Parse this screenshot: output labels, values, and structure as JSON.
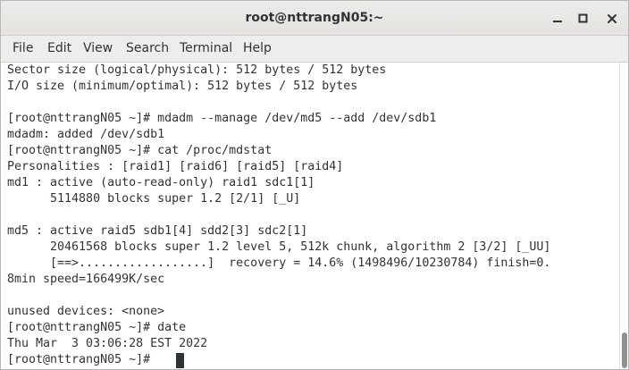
{
  "window": {
    "title": "root@nttrangN05:~"
  },
  "menu": {
    "items": [
      "File",
      "Edit",
      "View",
      "Search",
      "Terminal",
      "Help"
    ]
  },
  "terminal": {
    "lines": [
      "Sector size (logical/physical): 512 bytes / 512 bytes",
      "I/O size (minimum/optimal): 512 bytes / 512 bytes",
      "",
      "[root@nttrangN05 ~]# mdadm --manage /dev/md5 --add /dev/sdb1",
      "mdadm: added /dev/sdb1",
      "[root@nttrangN05 ~]# cat /proc/mdstat",
      "Personalities : [raid1] [raid6] [raid5] [raid4]",
      "md1 : active (auto-read-only) raid1 sdc1[1]",
      "      5114880 blocks super 1.2 [2/1] [_U]",
      "",
      "md5 : active raid5 sdb1[4] sdd2[3] sdc2[1]",
      "      20461568 blocks super 1.2 level 5, 512k chunk, algorithm 2 [3/2] [_UU]",
      "      [==>..................]  recovery = 14.6% (1498496/10230784) finish=0.",
      "8min speed=166499K/sec",
      "",
      "unused devices: <none>",
      "[root@nttrangN05 ~]# date",
      "Thu Mar  3 03:06:28 EST 2022",
      "[root@nttrangN05 ~]# "
    ]
  },
  "icons": {
    "minimize": "minimize-icon",
    "maximize": "maximize-icon",
    "close": "close-icon"
  },
  "colors": {
    "text": "#2e3436",
    "background": "#ffffff",
    "titlebar": "#e8e7e5",
    "menubar": "#ededeb",
    "scroll_thumb": "#8f918d"
  },
  "scrollbar": {
    "position": 1.0
  }
}
